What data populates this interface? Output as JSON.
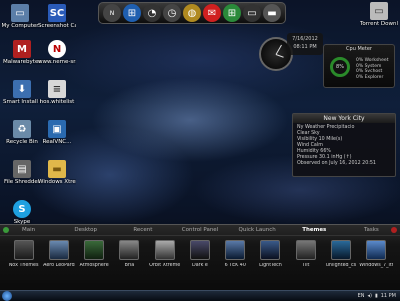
{
  "desktop_icons": [
    {
      "label": "My Computer",
      "icon": "computer-icon",
      "color": "#5b7ea8",
      "glyph": "▭"
    },
    {
      "label": "Screenshot Captor",
      "icon": "screenshot-icon",
      "color": "#2a5bb8",
      "glyph": "SC"
    },
    {
      "label": "Malwarebytes Anti-Malware",
      "icon": "malwarebytes-icon",
      "color": "#b02020",
      "glyph": "M"
    },
    {
      "label": "www.neme-sra...",
      "icon": "nemesis-icon",
      "color": "#222222",
      "glyph": "N"
    },
    {
      "label": "Smart Install Maker",
      "icon": "installer-icon",
      "color": "#3c6fb0",
      "glyph": "⬇"
    },
    {
      "label": "nos.whitelist",
      "icon": "document-icon",
      "color": "#d8d8d8",
      "glyph": "≡"
    },
    {
      "label": "Recycle Bin",
      "icon": "recycle-bin-icon",
      "color": "#6a8aa8",
      "glyph": "♻"
    },
    {
      "label": "RealVNC...",
      "icon": "remote-desktop-icon",
      "color": "#2a6ab0",
      "glyph": "▣"
    },
    {
      "label": "File Shredder",
      "icon": "shredder-icon",
      "color": "#666666",
      "glyph": "▤"
    },
    {
      "label": "Windows Xtreme v10.2(Desktop...",
      "icon": "folder-icon",
      "color": "#e0b84a",
      "glyph": "▬"
    },
    {
      "label": "Skype",
      "icon": "skype-icon",
      "color": "#1ea0e0",
      "glyph": "S"
    }
  ],
  "dock_items": [
    {
      "icon": "nexus-icon",
      "color": "#444444",
      "glyph": "N"
    },
    {
      "icon": "windows-icon",
      "color": "#1f5fb0",
      "glyph": "⊞"
    },
    {
      "icon": "speedometer-icon",
      "color": "#333333",
      "glyph": "◔"
    },
    {
      "icon": "clock-icon",
      "color": "#444444",
      "glyph": "◷"
    },
    {
      "icon": "globe-icon",
      "color": "#b08a20",
      "glyph": "◍"
    },
    {
      "icon": "pdf-icon",
      "color": "#d02020",
      "glyph": "✉"
    },
    {
      "icon": "windows-logo-icon",
      "color": "#2a8a3a",
      "glyph": "⊞"
    },
    {
      "icon": "monitor-icon",
      "color": "#333333",
      "glyph": "▭"
    },
    {
      "icon": "folder-icon",
      "color": "#555555",
      "glyph": "▬"
    }
  ],
  "torrent_label": "Torrent Downloaded Pro...",
  "clock": {
    "date": "7/16/2012",
    "time": "08:11 PM"
  },
  "cpu_meter": {
    "title": "Cpu Meter",
    "percent": "8%",
    "lines": [
      "0% Worksheet",
      "0% System",
      "0% Svchost",
      "0% Explorer"
    ]
  },
  "weather": {
    "title": "New York City",
    "lines": [
      "Ny Weather Precipitacio",
      "Clear Sky",
      "Visibility 10 Mile(s)",
      "Wind Calm",
      "Humidity 66%",
      "Pressure 30.1 inHg (↑)",
      "Observed on July 16, 2012 20:51"
    ]
  },
  "launcher": {
    "tabs": [
      "Main",
      "Desktop",
      "Recent",
      "Control Panel",
      "Quick Launch",
      "Themes",
      "Tasks"
    ],
    "active_tab": "Themes",
    "tiles": [
      "Nox Themes",
      "Aero LeoPard",
      "Atmosphere",
      "Bria",
      "Orbit Xtreme",
      "Dark e",
      "6 TEK 40",
      "LightTech",
      "Tilt",
      "unlighted_cs",
      "Windows_7_itre"
    ]
  },
  "taskbar": {
    "time": "11 PM",
    "language": "EN"
  }
}
